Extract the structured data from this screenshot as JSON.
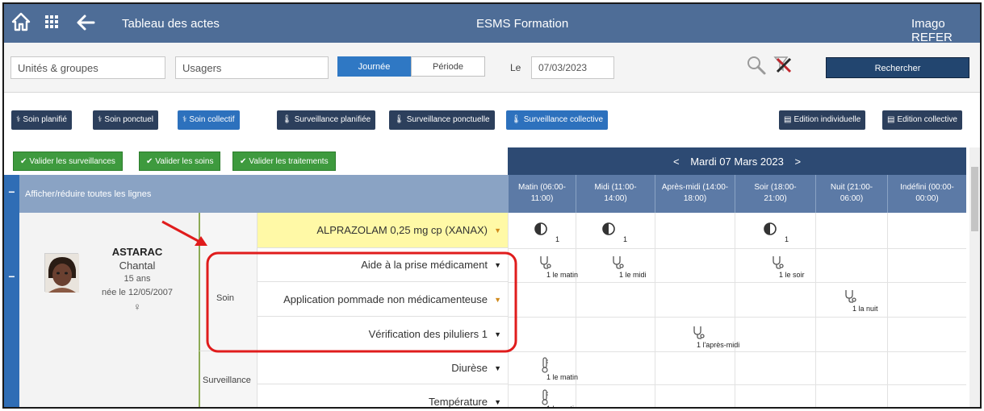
{
  "topbar": {
    "screen_title": "Tableau des actes",
    "center_title": "ESMS Formation",
    "right_title": "Imago REFER",
    "icons": [
      "home-icon",
      "apps-grid-icon",
      "back-arrow-icon"
    ]
  },
  "filters": {
    "units_placeholder": "Unités & groupes",
    "users_placeholder": "Usagers",
    "mode_journee": "Journée",
    "mode_periode": "Période",
    "date_label": "Le",
    "date_value": "07/03/2023",
    "search_button": "Rechercher"
  },
  "actions": {
    "soin_planifie": "Soin planifié",
    "soin_ponctuel": "Soin ponctuel",
    "soin_collectif": "Soin collectif",
    "surv_planifiee": "Surveillance planifiée",
    "surv_ponctuelle": "Surveillance ponctuelle",
    "surv_collective": "Surveillance collective",
    "edition_individuelle": "Edition individuelle",
    "edition_collective": "Edition collective"
  },
  "validation": {
    "surveillances": "Valider les surveillances",
    "soins": "Valider les soins",
    "traitements": "Valider les traitements"
  },
  "day_nav": {
    "prev": "<",
    "label": "Mardi 07 Mars 2023",
    "next": ">"
  },
  "grid": {
    "expand_all": "Afficher/réduire toutes les lignes",
    "collapse_symbol": "−",
    "columns": [
      {
        "l1": "Matin (06:00-",
        "l2": "11:00)"
      },
      {
        "l1": "Midi (11:00-",
        "l2": "14:00)"
      },
      {
        "l1": "Après-midi (14:00-",
        "l2": "18:00)"
      },
      {
        "l1": "Soir (18:00-",
        "l2": "21:00)"
      },
      {
        "l1": "Nuit (21:00-",
        "l2": "06:00)"
      },
      {
        "l1": "Indéfini (00:00-",
        "l2": "00:00)"
      }
    ]
  },
  "patient": {
    "last_name": "ASTARAC",
    "first_name": "Chantal",
    "age": "15 ans",
    "birth": "née le 12/05/2007",
    "sex_symbol": "♀"
  },
  "categories": {
    "soin": "Soin",
    "surveillance": "Surveillance"
  },
  "rows": {
    "alprazolam": "ALPRAZOLAM 0,25 mg cp (XANAX)",
    "aide_prise": "Aide à la prise médicament",
    "application_pommade": "Application pommade non médicamenteuse",
    "verification_piluliers": "Vérification des piluliers 1",
    "diurese": "Diurèse",
    "temperature": "Température"
  },
  "cells": {
    "dose": "1",
    "le_matin": "1 le matin",
    "le_midi": "1 le midi",
    "le_soir": "1 le soir",
    "la_nuit": "1 la nuit",
    "l_apres_midi": "1 l'après-midi"
  },
  "colors": {
    "topbar": "#4e6d97",
    "accent_blue": "#2d71bd",
    "dark_button": "#2c3f5c",
    "valid_green": "#3e9a3e",
    "treatment_highlight": "#fff9a6",
    "annotation_red": "#e01c1c"
  }
}
